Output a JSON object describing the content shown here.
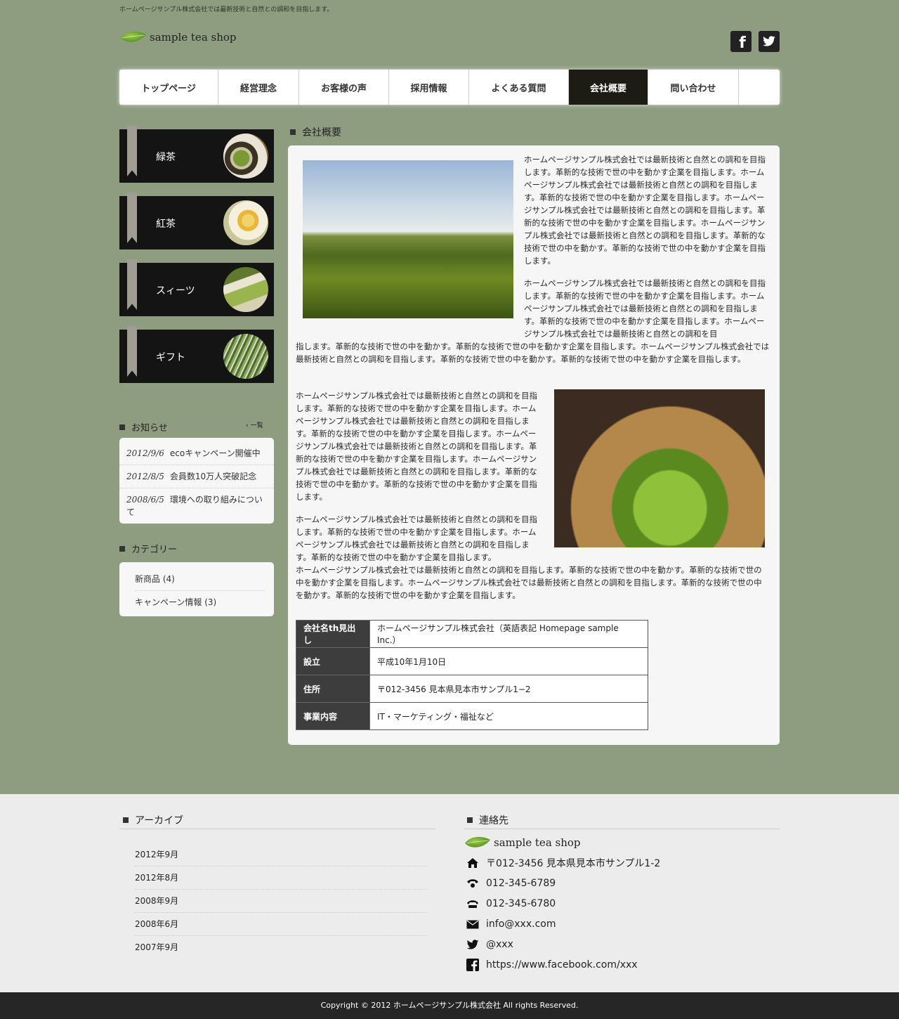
{
  "header": {
    "tagline": "ホームページサンプル株式会社では最新技術と自然との調和を目指します。",
    "logo_text": "sample tea shop",
    "facebook_label": "f"
  },
  "nav": {
    "items": [
      {
        "label": "トップページ"
      },
      {
        "label": "経営理念"
      },
      {
        "label": "お客様の声"
      },
      {
        "label": "採用情報"
      },
      {
        "label": "よくある質問"
      },
      {
        "label": "会社概要",
        "active": true
      },
      {
        "label": "問い合わせ"
      }
    ]
  },
  "sidebar": {
    "banners": [
      {
        "label": "緑茶"
      },
      {
        "label": "紅茶"
      },
      {
        "label": "スィーツ"
      },
      {
        "label": "ギフト"
      }
    ],
    "news_title": "お知らせ",
    "news_more": "一覧",
    "news": [
      {
        "date": "2012/9/6",
        "text": "ecoキャンペーン開催中"
      },
      {
        "date": "2012/8/5",
        "text": "会員数10万人突破記念"
      },
      {
        "date": "2008/6/5",
        "text": "環境への取り組みについて"
      }
    ],
    "category_title": "カテゴリー",
    "categories": [
      {
        "label": "新商品 (4)"
      },
      {
        "label": "キャンペーン情報 (3)"
      }
    ]
  },
  "main": {
    "heading": "会社概要",
    "para1": "ホームページサンプル株式会社では最新技術と自然との調和を目指します。革新的な技術で世の中を動かす企業を目指します。ホームページサンプル株式会社では最新技術と自然との調和を目指します。革新的な技術で世の中を動かす企業を目指します。ホームページサンプル株式会社では最新技術と自然との調和を目指します。革新的な技術で世の中を動かす企業を目指します。ホームページサンプル株式会社では最新技術と自然との調和を目指します。革新的な技術で世の中を動かす。革新的な技術で世の中を動かす企業を目指します。",
    "para2a": "ホームページサンプル株式会社では最新技術と自然との調和を目指します。革新的な技術で世の中を動かす企業を目指します。ホームページサンプル株式会社では最新技術と自然との調和を目指します。革新的な技術で世の中を動かす企業を目指します。ホームページサンプル株式会社では最新技術と自然との調和を目",
    "para2b": "指します。革新的な技術で世の中を動かす。革新的な技術で世の中を動かす企業を目指します。ホームページサンプル株式会社では最新技術と自然との調和を目指します。革新的な技術で世の中を動かす。革新的な技術で世の中を動かす企業を目指します。",
    "para3": "ホームページサンプル株式会社では最新技術と自然との調和を目指します。革新的な技術で世の中を動かす企業を目指します。ホームページサンプル株式会社では最新技術と自然との調和を目指します。革新的な技術で世の中を動かす企業を目指します。ホームページサンプル株式会社では最新技術と自然との調和を目指します。革新的な技術で世の中を動かす企業を目指します。ホームページサンプル株式会社では最新技術と自然との調和を目指します。革新的な技術で世の中を動かす。革新的な技術で世の中を動かす企業を目指します。",
    "para4a": "ホームページサンプル株式会社では最新技術と自然との調和を目指します。革新的な技術で世の中を動かす企業を目指します。ホームページサンプル株式会社では最新技術と自然との調和を目指します。革新的な技術で世の中を動かす企業を目指します。",
    "para4b": "ホームページサンプル株式会社では最新技術と自然との調和を目指します。革新的な技術で世の中を動かす。革新的な技術で世の中を動かす企業を目指します。ホームページサンプル株式会社では最新技術と自然との調和を目指します。革新的な技術で世の中を動かす。革新的な技術で世の中を動かす企業を目指します。",
    "table": [
      {
        "th": "会社名th見出し",
        "td": "ホームページサンプル株式会社（英語表記 Homepage sample Inc.）"
      },
      {
        "th": "設立",
        "td": "平成10年1月10日"
      },
      {
        "th": "住所",
        "td": "〒012-3456 見本県見本市サンプル1−2"
      },
      {
        "th": "事業内容",
        "td": "IT・マーケティング・福祉など"
      }
    ]
  },
  "footer": {
    "archive_title": "アーカイブ",
    "archives": [
      {
        "label": "2012年9月"
      },
      {
        "label": "2012年8月"
      },
      {
        "label": "2008年9月"
      },
      {
        "label": "2008年6月"
      },
      {
        "label": "2007年9月"
      }
    ],
    "contact_title": "連絡先",
    "contact_logo": "sample tea shop",
    "address": "〒012-3456 見本県見本市サンプル1-2",
    "tel": "012-345-6789",
    "fax": "012-345-6780",
    "email": "info@xxx.com",
    "twitter": "@xxx",
    "facebook": "https://www.facebook.com/xxx",
    "copyright": "Copyright © 2012 ホームページサンプル株式会社 All rights Reserved."
  }
}
